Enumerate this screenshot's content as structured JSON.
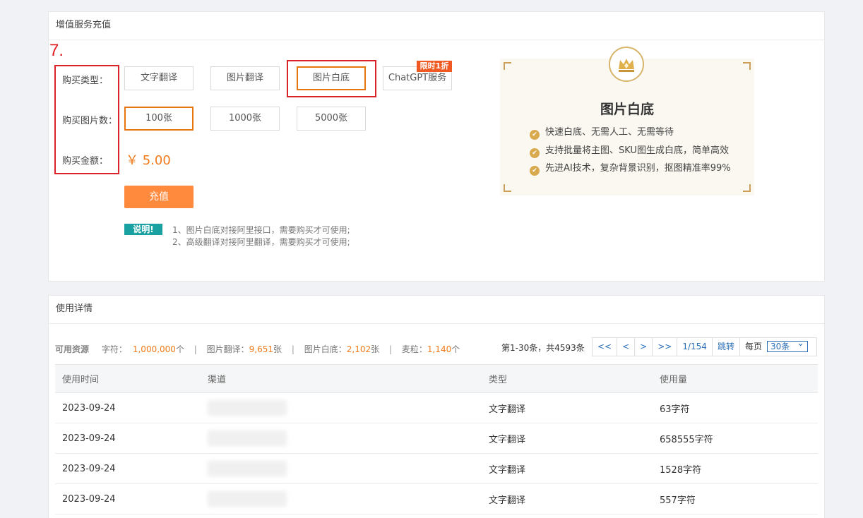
{
  "recharge": {
    "header": "增值服务充值",
    "step": "7.",
    "labels": {
      "type": "购买类型：",
      "count": "购买图片数：",
      "amount": "购买金额："
    },
    "types": [
      "文字翻译",
      "图片翻译",
      "图片白底",
      "ChatGPT服务"
    ],
    "selected_type": "图片白底",
    "promo_tag": "限时1折",
    "counts": [
      "100张",
      "1000张",
      "5000张"
    ],
    "selected_count": "100张",
    "price": "￥ 5.00",
    "submit": "充值",
    "note_badge": "说明!",
    "notes": [
      "1、图片白底对接阿里接口，需要购买才可使用;",
      "2、高级翻译对接阿里翻译，需要购买才可使用;"
    ]
  },
  "promo": {
    "title": "图片白底",
    "features": [
      "快速白底、无需人工、无需等待",
      "支持批量将主图、SKU图生成白底，简单高效",
      "先进AI技术，复杂背景识别，抠图精准率99%"
    ],
    "accent": "#c9a15a"
  },
  "usage": {
    "header": "使用详情",
    "resources_label": "可用资源",
    "resources": [
      {
        "name": "字符：",
        "value": "1,000,000",
        "unit": "个"
      },
      {
        "name": "图片翻译：",
        "value": "9,651",
        "unit": "张"
      },
      {
        "name": "图片白底：",
        "value": "2,102",
        "unit": "张"
      },
      {
        "name": "麦粒：",
        "value": "1,140",
        "unit": "个"
      }
    ],
    "separator": "|",
    "pagination": {
      "total_text": "第1-30条，共4593条",
      "first": "<<",
      "prev": "<",
      "next": ">",
      "last": ">>",
      "page": "1/154",
      "jump": "跳转",
      "per_page_label": "每页",
      "per_page": "30条"
    },
    "columns": [
      "使用时间",
      "渠道",
      "类型",
      "使用量"
    ],
    "rows": [
      {
        "time": "2023-09-24",
        "type": "文字翻译",
        "amount": "63字符"
      },
      {
        "time": "2023-09-24",
        "type": "文字翻译",
        "amount": "658555字符"
      },
      {
        "time": "2023-09-24",
        "type": "文字翻译",
        "amount": "1528字符"
      },
      {
        "time": "2023-09-24",
        "type": "文字翻译",
        "amount": "557字符"
      }
    ]
  },
  "colors": {
    "accent_orange": "#e8760e",
    "highlight_red": "#d8232a",
    "link_blue": "#2a6fb8"
  }
}
